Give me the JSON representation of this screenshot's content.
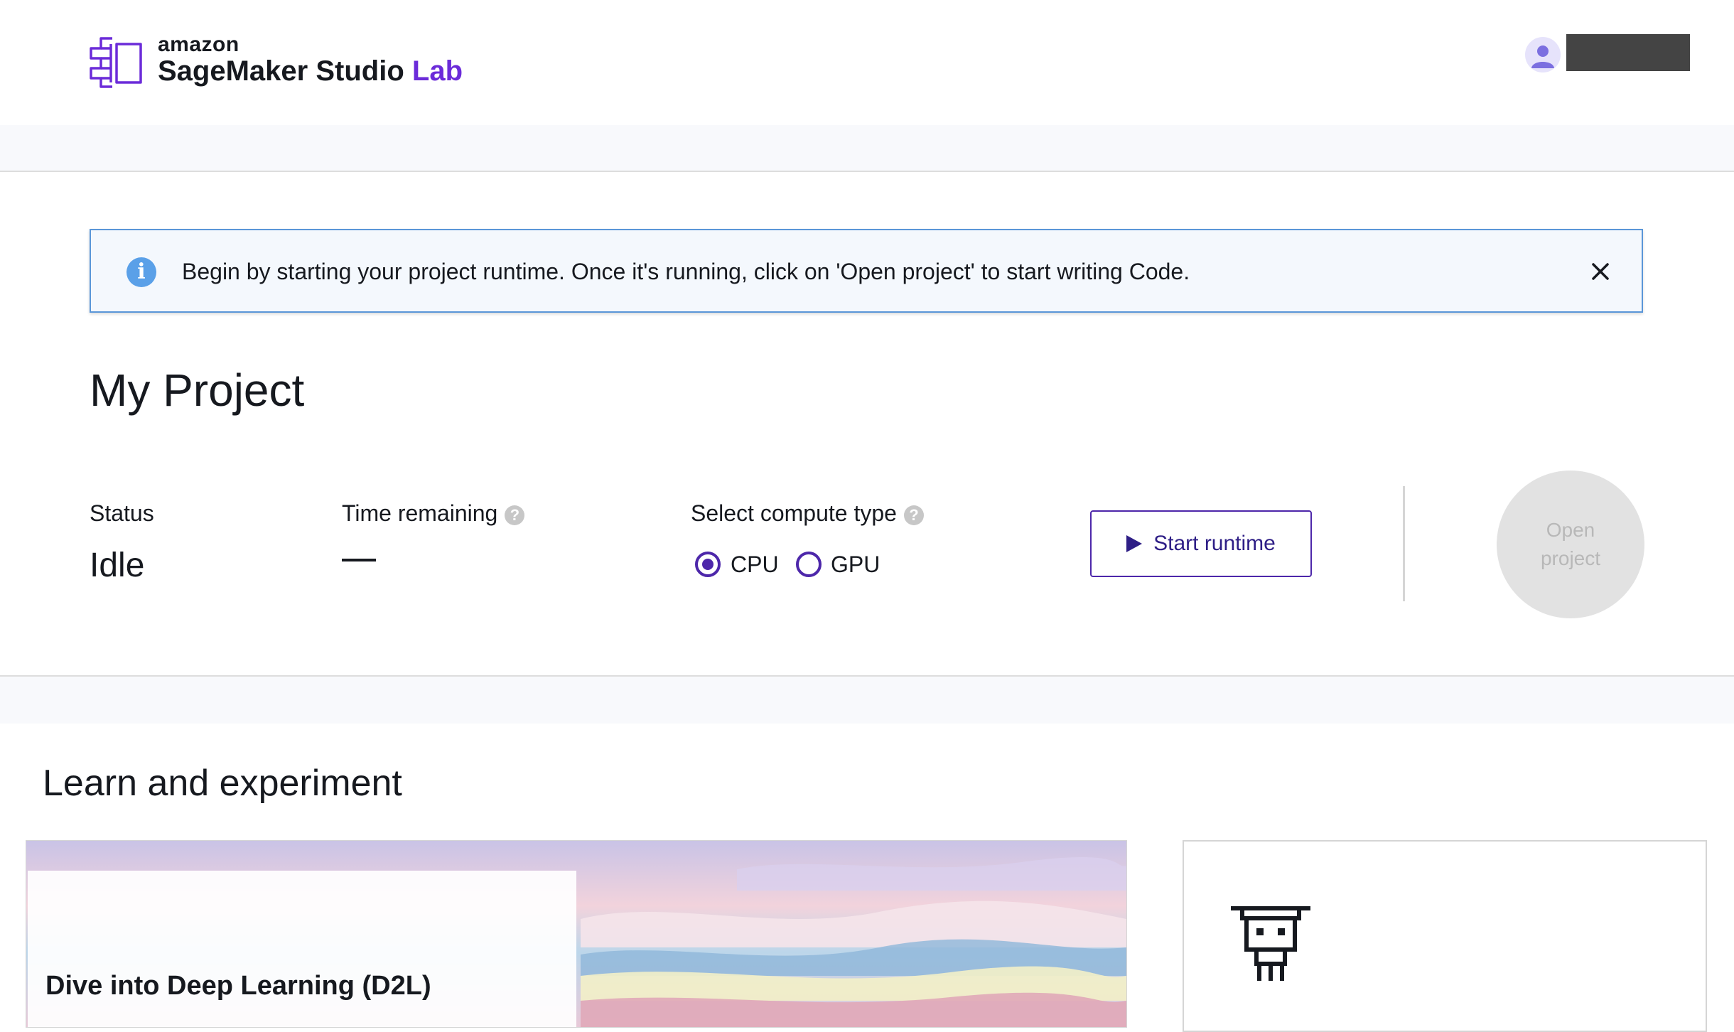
{
  "header": {
    "logo_amazon": "amazon",
    "logo_product": "SageMaker Studio",
    "logo_lab": "Lab",
    "avatar_icon": "user-avatar-icon",
    "logo_icon": "sagemaker-studio-lab-logo-icon"
  },
  "alert": {
    "icon": "info-icon",
    "icon_glyph": "i",
    "text": "Begin by starting your project runtime. Once it's running, click on 'Open project' to start writing Code.",
    "close_icon": "close-icon"
  },
  "project": {
    "title": "My Project",
    "status_label": "Status",
    "status_value": "Idle",
    "time_label": "Time remaining",
    "compute_label": "Select compute type",
    "help_glyph": "?",
    "compute_options": [
      {
        "label": "CPU",
        "selected": true
      },
      {
        "label": "GPU",
        "selected": false
      }
    ],
    "start_button": "Start runtime",
    "open_button": "Open\nproject"
  },
  "learn": {
    "title": "Learn and experiment",
    "cards": [
      {
        "title": "Dive into Deep Learning (D2L)"
      },
      {
        "icon": "robot-icon"
      }
    ]
  },
  "colors": {
    "brand_purple": "#6b2bd9",
    "radio_purple": "#4d27aa",
    "info_blue": "#5aa0e8",
    "alert_border": "#5a96d8"
  }
}
